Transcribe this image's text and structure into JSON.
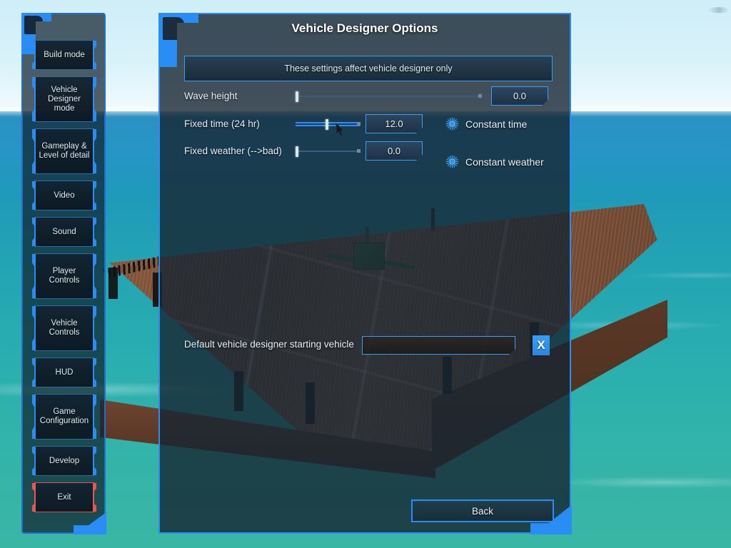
{
  "sidebar": {
    "items": [
      {
        "label": "Build mode",
        "name": "sidebar-item-build-mode",
        "size": "h1",
        "danger": false
      },
      {
        "label": "Vehicle Designer mode",
        "name": "sidebar-item-vehicle-designer-mode",
        "size": "h2",
        "danger": false
      },
      {
        "label": "Gameplay & Level of detail",
        "name": "sidebar-item-gameplay-level-of-detail",
        "size": "h2",
        "danger": false
      },
      {
        "label": "Video",
        "name": "sidebar-item-video",
        "size": "h1",
        "danger": false
      },
      {
        "label": "Sound",
        "name": "sidebar-item-sound",
        "size": "h1",
        "danger": false
      },
      {
        "label": "Player Controls",
        "name": "sidebar-item-player-controls",
        "size": "h2",
        "danger": false
      },
      {
        "label": "Vehicle Controls",
        "name": "sidebar-item-vehicle-controls",
        "size": "h2",
        "danger": false
      },
      {
        "label": "HUD",
        "name": "sidebar-item-hud",
        "size": "h1",
        "danger": false
      },
      {
        "label": "Game Configuration",
        "name": "sidebar-item-game-configuration",
        "size": "h2",
        "danger": false
      },
      {
        "label": "Develop",
        "name": "sidebar-item-develop",
        "size": "h1",
        "danger": false
      },
      {
        "label": "Exit",
        "name": "sidebar-item-exit",
        "size": "h1",
        "danger": true
      }
    ]
  },
  "panel": {
    "title": "Vehicle Designer Options",
    "subtitle": "These settings affect vehicle designer only",
    "settings": [
      {
        "label": "Wave height",
        "value": "0.0",
        "slider_percent": 0,
        "slider_highlighted": false,
        "checkbox": null
      },
      {
        "label": "Fixed time (24 hr)",
        "value": "12.0",
        "slider_percent": 50,
        "slider_highlighted": true,
        "checkbox": {
          "label": "Constant time",
          "icon": "starburst-icon",
          "checked": true
        }
      },
      {
        "label": "Fixed weather (-->bad)",
        "value": "0.0",
        "slider_percent": 0,
        "slider_highlighted": false,
        "checkbox": {
          "label": "Constant weather",
          "icon": "starburst-icon",
          "checked": true
        }
      }
    ],
    "default_vehicle": {
      "label": "Default vehicle designer starting vehicle",
      "value": "",
      "placeholder": "",
      "clear_label": "X"
    },
    "back_label": "Back"
  },
  "colors": {
    "accent_blue": "#2a8cf5",
    "danger_red": "#e8564f",
    "panel_bg": "#16262f",
    "text": "#eaf2f8"
  }
}
